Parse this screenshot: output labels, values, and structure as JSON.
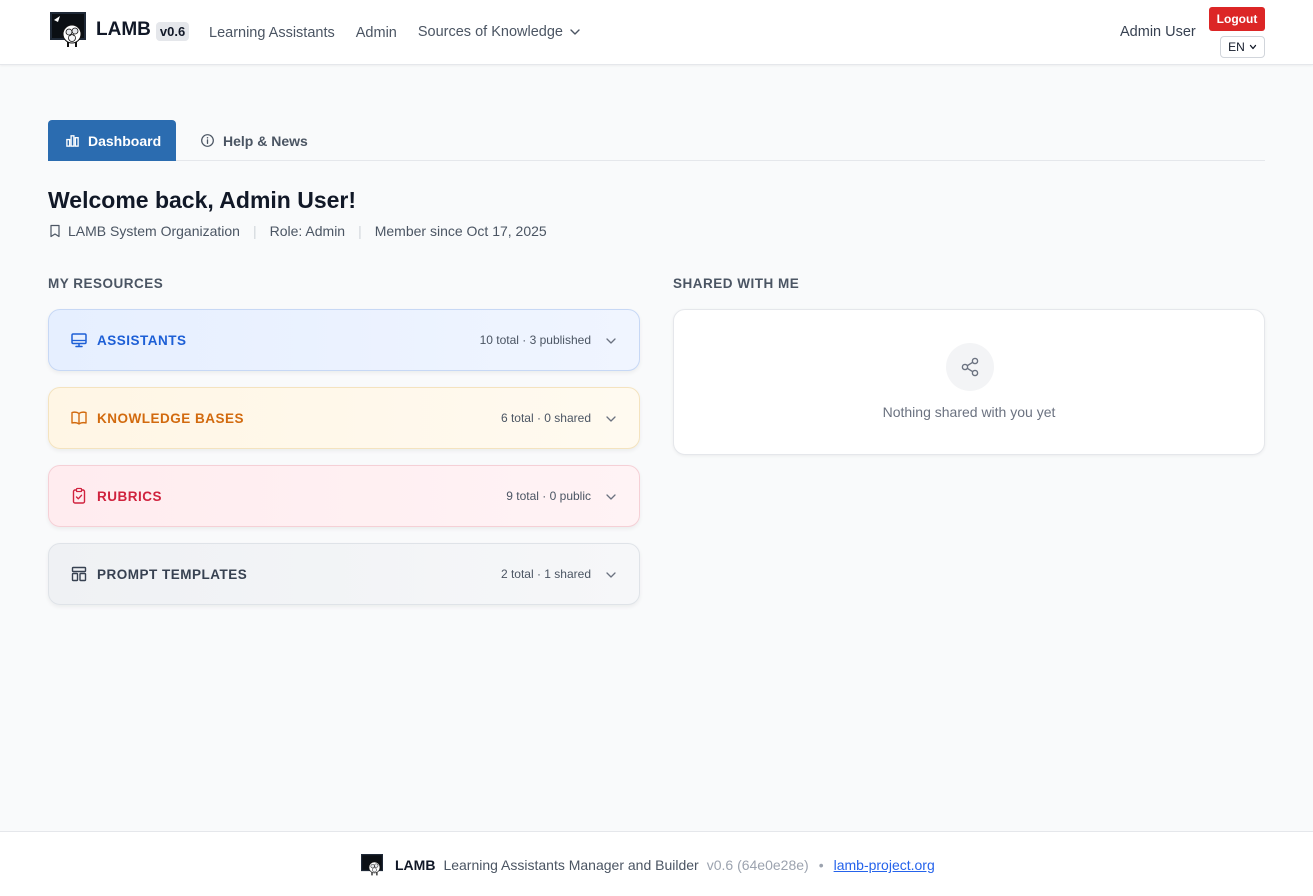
{
  "header": {
    "brand_name": "LAMB",
    "version": "v0.6",
    "nav": [
      "Learning Assistants",
      "Admin",
      "Sources of Knowledge"
    ],
    "user_name": "Admin User",
    "logout_label": "Logout",
    "language": "EN"
  },
  "tabs": [
    {
      "label": "Dashboard",
      "icon": "bar-chart-icon",
      "active": true
    },
    {
      "label": "Help & News",
      "icon": "info-icon",
      "active": false
    }
  ],
  "welcome": {
    "title": "Welcome back, Admin User!",
    "organization": "LAMB System Organization",
    "role": "Role: Admin",
    "member_since": "Member since Oct 17, 2025"
  },
  "my_resources": {
    "label": "MY RESOURCES",
    "items": [
      {
        "title": "ASSISTANTS",
        "summary": "10 total · 3 published",
        "icon": "monitor-icon",
        "color": "#1d5fd6"
      },
      {
        "title": "KNOWLEDGE BASES",
        "summary": "6 total · 0 shared",
        "icon": "book-icon",
        "color": "#d26a0e"
      },
      {
        "title": "RUBRICS",
        "summary": "9 total · 0 public",
        "icon": "clipboard-check-icon",
        "color": "#d0223e"
      },
      {
        "title": "PROMPT TEMPLATES",
        "summary": "2 total · 1 shared",
        "icon": "template-icon",
        "color": "#374151"
      }
    ]
  },
  "shared": {
    "label": "SHARED WITH ME",
    "empty_text": "Nothing shared with you yet",
    "icon": "share-icon"
  },
  "footer": {
    "name": "LAMB",
    "description": "Learning Assistants Manager and Builder",
    "version": "v0.6 (64e0e28e)",
    "separator": "•",
    "link": "lamb-project.org"
  }
}
